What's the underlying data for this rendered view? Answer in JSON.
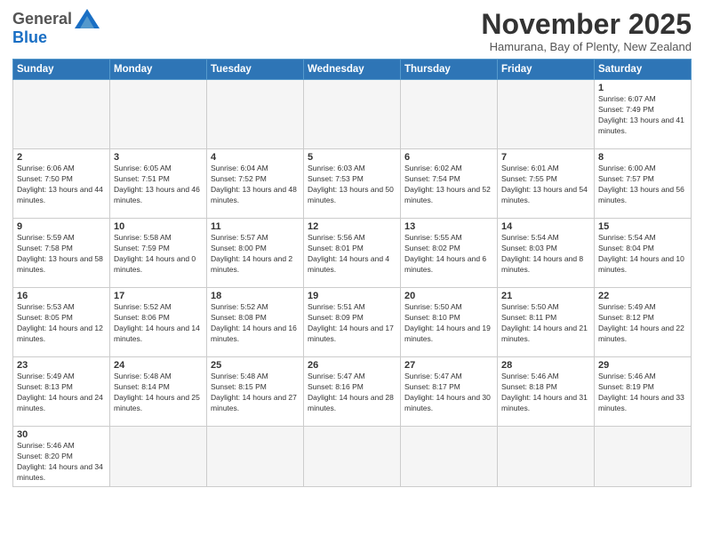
{
  "logo": {
    "general": "General",
    "blue": "Blue"
  },
  "header": {
    "title": "November 2025",
    "subtitle": "Hamurana, Bay of Plenty, New Zealand"
  },
  "weekdays": [
    "Sunday",
    "Monday",
    "Tuesday",
    "Wednesday",
    "Thursday",
    "Friday",
    "Saturday"
  ],
  "days": {
    "d1": {
      "num": "1",
      "sunrise": "6:07 AM",
      "sunset": "7:49 PM",
      "daylight": "13 hours and 41 minutes."
    },
    "d2": {
      "num": "2",
      "sunrise": "6:06 AM",
      "sunset": "7:50 PM",
      "daylight": "13 hours and 44 minutes."
    },
    "d3": {
      "num": "3",
      "sunrise": "6:05 AM",
      "sunset": "7:51 PM",
      "daylight": "13 hours and 46 minutes."
    },
    "d4": {
      "num": "4",
      "sunrise": "6:04 AM",
      "sunset": "7:52 PM",
      "daylight": "13 hours and 48 minutes."
    },
    "d5": {
      "num": "5",
      "sunrise": "6:03 AM",
      "sunset": "7:53 PM",
      "daylight": "13 hours and 50 minutes."
    },
    "d6": {
      "num": "6",
      "sunrise": "6:02 AM",
      "sunset": "7:54 PM",
      "daylight": "13 hours and 52 minutes."
    },
    "d7": {
      "num": "7",
      "sunrise": "6:01 AM",
      "sunset": "7:55 PM",
      "daylight": "13 hours and 54 minutes."
    },
    "d8": {
      "num": "8",
      "sunrise": "6:00 AM",
      "sunset": "7:57 PM",
      "daylight": "13 hours and 56 minutes."
    },
    "d9": {
      "num": "9",
      "sunrise": "5:59 AM",
      "sunset": "7:58 PM",
      "daylight": "13 hours and 58 minutes."
    },
    "d10": {
      "num": "10",
      "sunrise": "5:58 AM",
      "sunset": "7:59 PM",
      "daylight": "14 hours and 0 minutes."
    },
    "d11": {
      "num": "11",
      "sunrise": "5:57 AM",
      "sunset": "8:00 PM",
      "daylight": "14 hours and 2 minutes."
    },
    "d12": {
      "num": "12",
      "sunrise": "5:56 AM",
      "sunset": "8:01 PM",
      "daylight": "14 hours and 4 minutes."
    },
    "d13": {
      "num": "13",
      "sunrise": "5:55 AM",
      "sunset": "8:02 PM",
      "daylight": "14 hours and 6 minutes."
    },
    "d14": {
      "num": "14",
      "sunrise": "5:54 AM",
      "sunset": "8:03 PM",
      "daylight": "14 hours and 8 minutes."
    },
    "d15": {
      "num": "15",
      "sunrise": "5:54 AM",
      "sunset": "8:04 PM",
      "daylight": "14 hours and 10 minutes."
    },
    "d16": {
      "num": "16",
      "sunrise": "5:53 AM",
      "sunset": "8:05 PM",
      "daylight": "14 hours and 12 minutes."
    },
    "d17": {
      "num": "17",
      "sunrise": "5:52 AM",
      "sunset": "8:06 PM",
      "daylight": "14 hours and 14 minutes."
    },
    "d18": {
      "num": "18",
      "sunrise": "5:52 AM",
      "sunset": "8:08 PM",
      "daylight": "14 hours and 16 minutes."
    },
    "d19": {
      "num": "19",
      "sunrise": "5:51 AM",
      "sunset": "8:09 PM",
      "daylight": "14 hours and 17 minutes."
    },
    "d20": {
      "num": "20",
      "sunrise": "5:50 AM",
      "sunset": "8:10 PM",
      "daylight": "14 hours and 19 minutes."
    },
    "d21": {
      "num": "21",
      "sunrise": "5:50 AM",
      "sunset": "8:11 PM",
      "daylight": "14 hours and 21 minutes."
    },
    "d22": {
      "num": "22",
      "sunrise": "5:49 AM",
      "sunset": "8:12 PM",
      "daylight": "14 hours and 22 minutes."
    },
    "d23": {
      "num": "23",
      "sunrise": "5:49 AM",
      "sunset": "8:13 PM",
      "daylight": "14 hours and 24 minutes."
    },
    "d24": {
      "num": "24",
      "sunrise": "5:48 AM",
      "sunset": "8:14 PM",
      "daylight": "14 hours and 25 minutes."
    },
    "d25": {
      "num": "25",
      "sunrise": "5:48 AM",
      "sunset": "8:15 PM",
      "daylight": "14 hours and 27 minutes."
    },
    "d26": {
      "num": "26",
      "sunrise": "5:47 AM",
      "sunset": "8:16 PM",
      "daylight": "14 hours and 28 minutes."
    },
    "d27": {
      "num": "27",
      "sunrise": "5:47 AM",
      "sunset": "8:17 PM",
      "daylight": "14 hours and 30 minutes."
    },
    "d28": {
      "num": "28",
      "sunrise": "5:46 AM",
      "sunset": "8:18 PM",
      "daylight": "14 hours and 31 minutes."
    },
    "d29": {
      "num": "29",
      "sunrise": "5:46 AM",
      "sunset": "8:19 PM",
      "daylight": "14 hours and 33 minutes."
    },
    "d30": {
      "num": "30",
      "sunrise": "5:46 AM",
      "sunset": "8:20 PM",
      "daylight": "14 hours and 34 minutes."
    }
  },
  "labels": {
    "sunrise": "Sunrise:",
    "sunset": "Sunset:",
    "daylight": "Daylight:"
  }
}
